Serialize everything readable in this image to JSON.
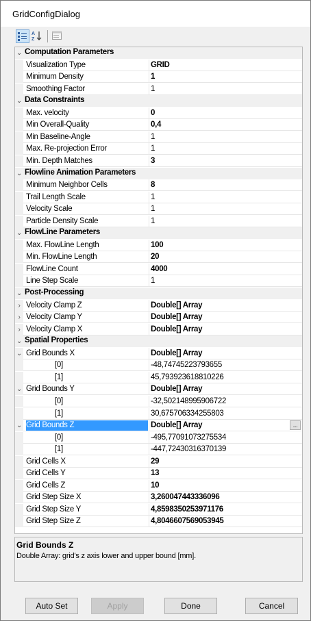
{
  "window": {
    "title": "GridConfigDialog"
  },
  "toolbar": {
    "buttons": [
      {
        "name": "categorized-view-icon",
        "active": true
      },
      {
        "name": "sort-alphabetical-icon",
        "active": false
      },
      {
        "name": "property-pages-icon",
        "active": false
      }
    ]
  },
  "grid": {
    "rows": [
      {
        "type": "cat",
        "label": "Computation Parameters",
        "expander": "⌄"
      },
      {
        "type": "prop",
        "name": "Visualization Type",
        "value": "GRID",
        "bold": true
      },
      {
        "type": "prop",
        "name": "Minimum Density",
        "value": "1",
        "bold": true
      },
      {
        "type": "prop",
        "name": "Smoothing Factor",
        "value": "1",
        "bold": false
      },
      {
        "type": "cat",
        "label": "Data Constraints",
        "expander": "⌄"
      },
      {
        "type": "prop",
        "name": "Max. velocity",
        "value": "0",
        "bold": true
      },
      {
        "type": "prop",
        "name": "Min Overall-Quality",
        "value": "0,4",
        "bold": true
      },
      {
        "type": "prop",
        "name": "Min Baseline-Angle",
        "value": "1",
        "bold": false
      },
      {
        "type": "prop",
        "name": "Max. Re-projection Error",
        "value": "1",
        "bold": false
      },
      {
        "type": "prop",
        "name": "Min. Depth Matches",
        "value": "3",
        "bold": true
      },
      {
        "type": "cat",
        "label": "Flowline Animation Parameters",
        "expander": "⌄"
      },
      {
        "type": "prop",
        "name": "Minimum Neighbor Cells",
        "value": "8",
        "bold": true
      },
      {
        "type": "prop",
        "name": "Trail Length Scale",
        "value": "1",
        "bold": false
      },
      {
        "type": "prop",
        "name": "Velocity Scale",
        "value": "1",
        "bold": false
      },
      {
        "type": "prop",
        "name": "Particle Density Scale",
        "value": "1",
        "bold": false
      },
      {
        "type": "cat",
        "label": "FlowLine Parameters",
        "expander": "⌄"
      },
      {
        "type": "prop",
        "name": "Max. FlowLine Length",
        "value": "100",
        "bold": true
      },
      {
        "type": "prop",
        "name": "Min. FlowLine Length",
        "value": "20",
        "bold": true
      },
      {
        "type": "prop",
        "name": "FlowLine Count",
        "value": "4000",
        "bold": true
      },
      {
        "type": "prop",
        "name": "Line Step Scale",
        "value": "1",
        "bold": false
      },
      {
        "type": "cat",
        "label": "Post-Processing",
        "expander": "⌄"
      },
      {
        "type": "prop",
        "name": "Velocity Clamp Z",
        "value": "Double[] Array",
        "bold": true,
        "expander": "›"
      },
      {
        "type": "prop",
        "name": "Velocity Clamp Y",
        "value": "Double[] Array",
        "bold": true,
        "expander": "›"
      },
      {
        "type": "prop",
        "name": "Velocity Clamp X",
        "value": "Double[] Array",
        "bold": true,
        "expander": "›"
      },
      {
        "type": "cat",
        "label": "Spatial Properties",
        "expander": "⌄"
      },
      {
        "type": "prop",
        "name": "Grid Bounds X",
        "value": "Double[] Array",
        "bold": true,
        "expander": "⌄"
      },
      {
        "type": "sub",
        "name": "[0]",
        "value": "-48,74745223793655",
        "bold": false
      },
      {
        "type": "sub",
        "name": "[1]",
        "value": "45,793923618810226",
        "bold": false
      },
      {
        "type": "prop",
        "name": "Grid Bounds Y",
        "value": "Double[] Array",
        "bold": true,
        "expander": "⌄"
      },
      {
        "type": "sub",
        "name": "[0]",
        "value": "-32,502148995906722",
        "bold": false
      },
      {
        "type": "sub",
        "name": "[1]",
        "value": "30,675706334255803",
        "bold": false
      },
      {
        "type": "prop",
        "name": "Grid Bounds Z",
        "value": "Double[] Array",
        "bold": true,
        "expander": "⌄",
        "selected": true,
        "ellipsis": "..."
      },
      {
        "type": "sub",
        "name": "[0]",
        "value": "-495,77091073275534",
        "bold": false
      },
      {
        "type": "sub",
        "name": "[1]",
        "value": "-447,72430316370139",
        "bold": false
      },
      {
        "type": "prop",
        "name": "Grid Cells X",
        "value": "29",
        "bold": true
      },
      {
        "type": "prop",
        "name": "Grid Cells Y",
        "value": "13",
        "bold": true
      },
      {
        "type": "prop",
        "name": "Grid Cells Z",
        "value": "10",
        "bold": true
      },
      {
        "type": "prop",
        "name": "Grid Step Size X",
        "value": "3,260047443336096",
        "bold": true
      },
      {
        "type": "prop",
        "name": "Grid Step Size Y",
        "value": "4,8598350253971176",
        "bold": true
      },
      {
        "type": "prop",
        "name": "Grid Step Size Z",
        "value": "4,8046607569053945",
        "bold": true
      }
    ]
  },
  "description": {
    "title": "Grid Bounds Z",
    "text": "Double Array: grid's z axis lower and upper bound [mm]."
  },
  "buttons": {
    "auto_set": "Auto Set",
    "apply": "Apply",
    "done": "Done",
    "cancel": "Cancel"
  },
  "colors": {
    "selection": "#3399ff",
    "category_bg": "#f0f0f0"
  }
}
